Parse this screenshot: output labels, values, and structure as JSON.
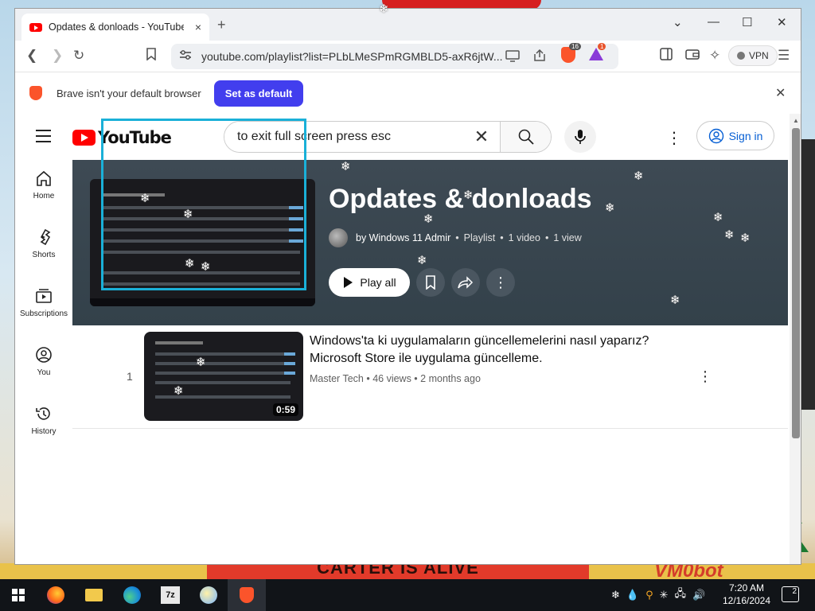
{
  "browser": {
    "tab_title": "Opdates & donloads - YouTube",
    "tab_close": "×",
    "new_tab": "+",
    "url": "youtube.com/playlist?list=PLbLMeSPmRGMBLD5-axR6jtW...",
    "shield_count": "16",
    "rewards_count": "1",
    "vpn_label": "VPN"
  },
  "infobar": {
    "message": "Brave isn't your default browser",
    "set_default_label": "Set as default"
  },
  "youtube": {
    "logo_text": "YouTube",
    "search_value": "to exit full screen press esc",
    "sign_in_label": "Sign in",
    "nav": [
      {
        "label": "Home"
      },
      {
        "label": "Shorts"
      },
      {
        "label": "Subscriptions"
      },
      {
        "label": "You"
      },
      {
        "label": "History"
      }
    ],
    "playlist": {
      "title": "Opdates & donloads",
      "author": "by Windows 11 Admir",
      "type": "Playlist",
      "video_count": "1 video",
      "views": "1 view",
      "play_all_label": "Play all"
    },
    "videos": [
      {
        "index": "1",
        "title": "Windows'ta ki uygulamaların güncellemelerini nasıl yaparız? Microsoft Store ile uygulama güncelleme.",
        "channel": "Master Tech",
        "views": "46 views",
        "age": "2 months ago",
        "duration": "0:59"
      }
    ]
  },
  "desktop": {
    "banner_text": "CARTER IS ALIVE",
    "logo_text": "VM0bot"
  },
  "taskbar": {
    "time": "7:20 AM",
    "date": "12/16/2024",
    "notifications": "2"
  },
  "colors": {
    "accent_brave": "#fb542b",
    "set_default_bg": "#423eee",
    "yt_red": "#ff0000",
    "hero_bg": "#3e4a54",
    "highlight_box": "#1ab0d8"
  }
}
